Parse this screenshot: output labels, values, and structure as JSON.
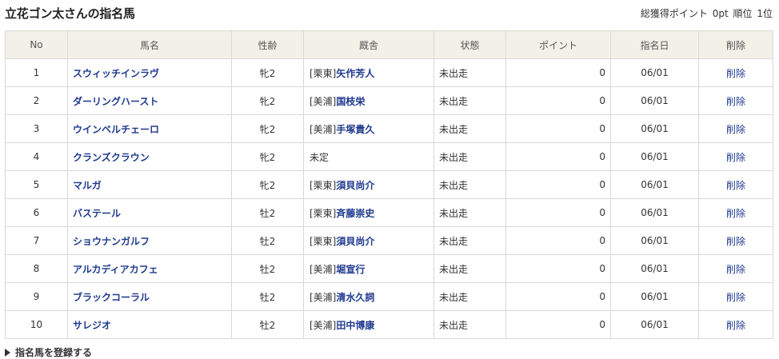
{
  "header": {
    "title": "立花ゴン太さんの指名馬",
    "points_label": "総獲得ポイント",
    "points_value": "0pt",
    "rank_label": "順位",
    "rank_value": "1位"
  },
  "table": {
    "columns": [
      "No",
      "馬名",
      "性齢",
      "厩舎",
      "状態",
      "ポイント",
      "指名日",
      "削除"
    ],
    "rows": [
      {
        "no": "1",
        "name": "スウィッチインラヴ",
        "sex_age": "牝2",
        "stable_prefix": "[栗東]",
        "trainer": "矢作芳人",
        "status": "未出走",
        "points": "0",
        "date": "06/01",
        "delete": "削除"
      },
      {
        "no": "2",
        "name": "ダーリングハースト",
        "sex_age": "牝2",
        "stable_prefix": "[美浦]",
        "trainer": "国枝栄",
        "status": "未出走",
        "points": "0",
        "date": "06/01",
        "delete": "削除"
      },
      {
        "no": "3",
        "name": "ウインベルチェーロ",
        "sex_age": "牝2",
        "stable_prefix": "[美浦]",
        "trainer": "手塚貴久",
        "status": "未出走",
        "points": "0",
        "date": "06/01",
        "delete": "削除"
      },
      {
        "no": "4",
        "name": "クランズクラウン",
        "sex_age": "牝2",
        "stable_prefix": "未定",
        "trainer": "",
        "status": "未出走",
        "points": "0",
        "date": "06/01",
        "delete": "削除"
      },
      {
        "no": "5",
        "name": "マルガ",
        "sex_age": "牝2",
        "stable_prefix": "[栗東]",
        "trainer": "須貝尚介",
        "status": "未出走",
        "points": "0",
        "date": "06/01",
        "delete": "削除"
      },
      {
        "no": "6",
        "name": "バステール",
        "sex_age": "牡2",
        "stable_prefix": "[栗東]",
        "trainer": "斉藤崇史",
        "status": "未出走",
        "points": "0",
        "date": "06/01",
        "delete": "削除"
      },
      {
        "no": "7",
        "name": "ショウナンガルフ",
        "sex_age": "牡2",
        "stable_prefix": "[栗東]",
        "trainer": "須貝尚介",
        "status": "未出走",
        "points": "0",
        "date": "06/01",
        "delete": "削除"
      },
      {
        "no": "8",
        "name": "アルカディアカフェ",
        "sex_age": "牡2",
        "stable_prefix": "[美浦]",
        "trainer": "堀宣行",
        "status": "未出走",
        "points": "0",
        "date": "06/01",
        "delete": "削除"
      },
      {
        "no": "9",
        "name": "ブラックコーラル",
        "sex_age": "牡2",
        "stable_prefix": "[美浦]",
        "trainer": "清水久詞",
        "status": "未出走",
        "points": "0",
        "date": "06/01",
        "delete": "削除"
      },
      {
        "no": "10",
        "name": "サレジオ",
        "sex_age": "牡2",
        "stable_prefix": "[美浦]",
        "trainer": "田中博康",
        "status": "未出走",
        "points": "0",
        "date": "06/01",
        "delete": "削除"
      }
    ]
  },
  "footer": {
    "register_label": "指名馬を登録する",
    "register_icon": "triangle-right-icon"
  },
  "colors": {
    "link": "#1f3a8f",
    "header_bg": "#f3f0e7",
    "border": "#d9d9d9"
  }
}
